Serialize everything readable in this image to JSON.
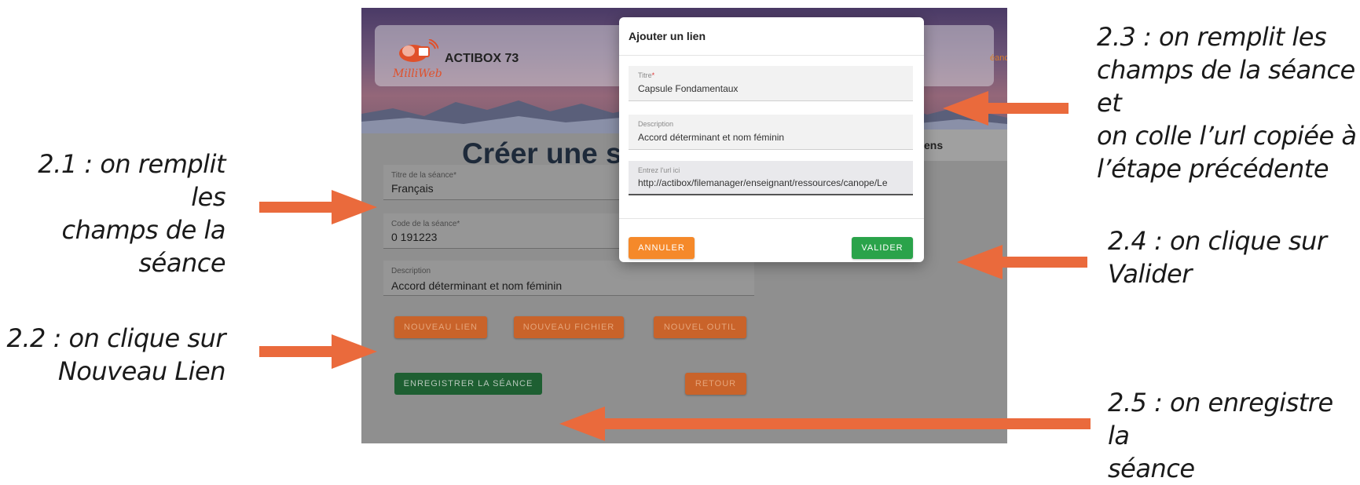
{
  "annotations": {
    "a21": [
      "2.1 : on remplit les",
      "champs de la séance"
    ],
    "a22": [
      "2.2 : on clique sur",
      "Nouveau Lien"
    ],
    "a23": [
      "2.3 : on remplit les",
      "champs de la séance et",
      "on colle l’url copiée à",
      "l’étape précédente"
    ],
    "a24": [
      "2.4 : on clique sur",
      "Valider"
    ],
    "a25": [
      "2.5 : on enregistre la",
      "séance"
    ]
  },
  "app": {
    "logo_text": "MilliWeb",
    "title": "ACTIBOX 73",
    "header_link_fragment": "éanc",
    "side_fragment": "ens"
  },
  "page": {
    "heading": "Créer une sé",
    "fields": {
      "titre_label": "Titre de la séance*",
      "titre_value": "Français",
      "code_label": "Code de la séance*",
      "code_value": "0 191223",
      "description_label": "Description",
      "description_value": "Accord déterminant et nom féminin"
    },
    "buttons": {
      "nouveau_lien": "NOUVEAU LIEN",
      "nouveau_fichier": "NOUVEAU FICHIER",
      "nouvel_outil": "NOUVEL OUTIL",
      "enregistrer": "ENREGISTRER LA SÉANCE",
      "retour": "RETOUR"
    }
  },
  "dialog": {
    "title": "Ajouter un lien",
    "titre_label": "Titre",
    "titre_required_mark": "*",
    "titre_value": "Capsule Fondamentaux",
    "description_label": "Description",
    "description_value": "Accord déterminant et nom féminin",
    "url_label": "Entrez l'url ici",
    "url_value": "http://actibox/filemanager/enseignant/ressources/canope/Le",
    "cancel_label": "ANNULER",
    "validate_label": "VALIDER"
  },
  "colors": {
    "arrow": "#ea6a3c",
    "orange_button": "#f5892a",
    "green_button": "#2aa34a"
  }
}
